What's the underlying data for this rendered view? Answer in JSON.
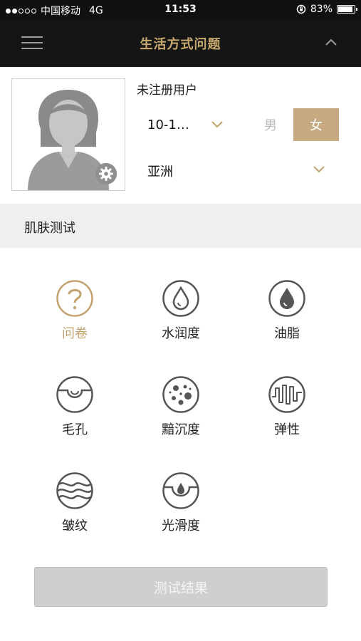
{
  "status_bar": {
    "carrier": "中国移动",
    "network": "4G",
    "time": "11:53",
    "battery_percent": "83%",
    "battery_level": 0.83,
    "signal_bars_filled": 2,
    "signal_bars_total": 5,
    "icons": [
      "signal-icon",
      "orientation-lock-icon",
      "battery-icon"
    ]
  },
  "navbar": {
    "title": "生活方式问题",
    "menu_icon": "hamburger-icon",
    "collapse_icon": "chevron-up-icon"
  },
  "profile": {
    "user_name": "未注册用户",
    "age_range": "10-1…",
    "gender_options": [
      "男",
      "女"
    ],
    "gender_selected": "女",
    "region": "亚洲",
    "avatar_icon": "female-avatar-placeholder",
    "settings_icon": "gear-icon"
  },
  "section": {
    "title": "肌肤测试"
  },
  "tests": [
    {
      "label": "问卷",
      "icon": "question-icon",
      "active": true
    },
    {
      "label": "水润度",
      "icon": "water-drop-outline-icon",
      "active": false
    },
    {
      "label": "油脂",
      "icon": "oil-drop-icon",
      "active": false
    },
    {
      "label": "毛孔",
      "icon": "pore-icon",
      "active": false
    },
    {
      "label": "黯沉度",
      "icon": "dull-spots-icon",
      "active": false
    },
    {
      "label": "弹性",
      "icon": "elasticity-wave-icon",
      "active": false
    },
    {
      "label": "皱纹",
      "icon": "wrinkle-icon",
      "active": false
    },
    {
      "label": "光滑度",
      "icon": "smoothness-icon",
      "active": false
    }
  ],
  "result_button": "测试结果",
  "colors": {
    "accent_gold": "#c8aa6e",
    "nav_bg": "#151515",
    "icon_gray": "#555555",
    "section_bg": "#efefef",
    "button_disabled": "#cfcfcf"
  }
}
